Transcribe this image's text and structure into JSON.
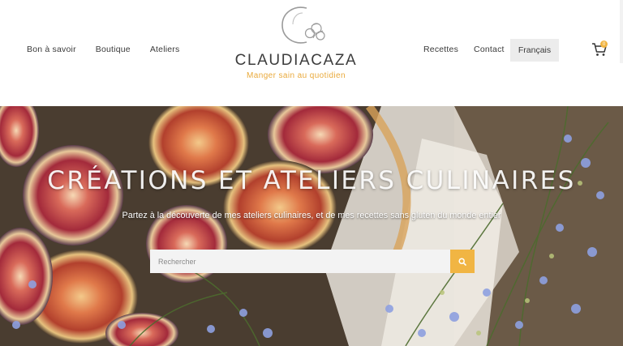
{
  "nav": {
    "left": [
      "Bon à savoir",
      "Boutique",
      "Ateliers"
    ],
    "right": [
      "Recettes",
      "Contact"
    ],
    "language": "Français",
    "cart_count": "0"
  },
  "logo": {
    "title": "CLAUDIACAZA",
    "tagline": "Manger sain au quotidien"
  },
  "hero": {
    "title": "CRÉATIONS ET ATELIERS CULINAIRES",
    "subtitle": "Partez à la découverte de mes ateliers culinaires, et de mes recettes sans gluten du monde entier"
  },
  "search": {
    "placeholder": "Rechercher",
    "value": ""
  },
  "colors": {
    "accent": "#f1b543",
    "text": "#3a3a3a",
    "lang_bg": "#ececec"
  },
  "icons": {
    "cart": "shopping-cart-icon",
    "search": "search-icon"
  }
}
